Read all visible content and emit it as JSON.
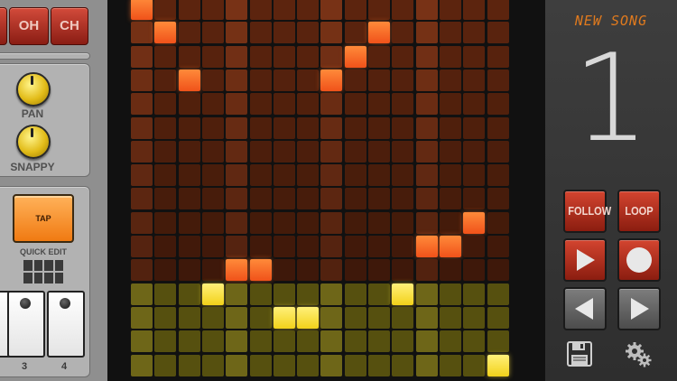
{
  "left_panel": {
    "instrument_buttons": [
      "OH",
      "CH"
    ],
    "knobs": [
      {
        "label": "PAN"
      },
      {
        "label": "SNAPPY"
      }
    ],
    "tap_label": "TAP",
    "quick_edit_label": "QUICK EDIT",
    "pads": [
      {
        "number": "3"
      },
      {
        "number": "4"
      }
    ]
  },
  "right_panel": {
    "song_title": "NEW SONG",
    "pattern_number": "1",
    "follow_label": "FOLLOW",
    "loop_label": "LOOP"
  },
  "colors": {
    "accent_orange": "#e07a1e",
    "cell_on_orange": "#ff6a2a",
    "cell_on_yellow": "#f6dc2a",
    "control_red": "#c23a28"
  },
  "icons": [
    "play-icon",
    "record-icon",
    "arrow-left-icon",
    "arrow-right-icon",
    "save-icon",
    "gear-icon"
  ],
  "sequencer": {
    "columns": 16,
    "upper_rows": 12,
    "lower_rows": 4,
    "active_upper": [
      [
        0,
        0
      ],
      [
        1,
        1
      ],
      [
        10,
        1
      ],
      [
        9,
        2
      ],
      [
        2,
        3
      ],
      [
        8,
        3
      ],
      [
        14,
        9
      ],
      [
        12,
        10
      ],
      [
        13,
        10
      ],
      [
        4,
        11
      ],
      [
        5,
        11
      ]
    ],
    "active_lower": [
      [
        3,
        0
      ],
      [
        11,
        0
      ],
      [
        6,
        1
      ],
      [
        7,
        1
      ],
      [
        15,
        3
      ]
    ]
  }
}
